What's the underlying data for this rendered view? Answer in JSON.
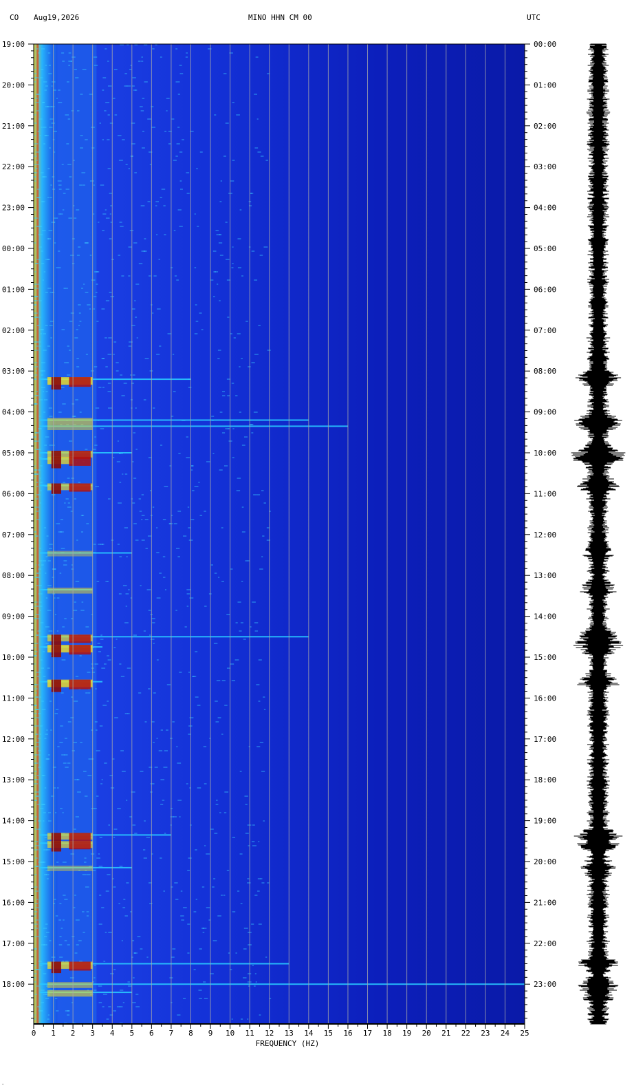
{
  "header": {
    "network": "CO",
    "date": "Aug19,2026",
    "station": "MINO HHN CM 00",
    "timezone": "UTC"
  },
  "footnote": "·",
  "colors": {
    "background_blue": "#0a1aa0",
    "deep_blue": "#0614c8",
    "cyan": "#29c8ff",
    "yellow": "#f5e020",
    "dark_red": "#8c0a0a",
    "gridline": "#a9a9a9"
  },
  "chart_data": {
    "type": "heatmap",
    "xlabel": "FREQUENCY (HZ)",
    "xlim": [
      0,
      25
    ],
    "x_ticks": [
      "0",
      "1",
      "2",
      "3",
      "4",
      "5",
      "6",
      "7",
      "8",
      "9",
      "10",
      "11",
      "12",
      "13",
      "14",
      "15",
      "16",
      "17",
      "18",
      "19",
      "20",
      "21",
      "22",
      "23",
      "24",
      "25"
    ],
    "left_time_labels": [
      "19:00",
      "20:00",
      "21:00",
      "22:00",
      "23:00",
      "00:00",
      "01:00",
      "02:00",
      "03:00",
      "04:00",
      "05:00",
      "06:00",
      "07:00",
      "08:00",
      "09:00",
      "10:00",
      "11:00",
      "12:00",
      "13:00",
      "14:00",
      "15:00",
      "16:00",
      "17:00",
      "18:00"
    ],
    "right_time_labels": [
      "00:00",
      "01:00",
      "02:00",
      "03:00",
      "04:00",
      "05:00",
      "06:00",
      "07:00",
      "08:00",
      "09:00",
      "10:00",
      "11:00",
      "12:00",
      "13:00",
      "14:00",
      "15:00",
      "16:00",
      "17:00",
      "18:00",
      "19:00",
      "20:00",
      "21:00",
      "22:00",
      "23:00"
    ],
    "hours_span": 24,
    "events": [
      {
        "hour": 8.2,
        "fmax": 8.0,
        "strength": 1.0
      },
      {
        "hour": 9.2,
        "fmax": 14.0,
        "strength": 0.7
      },
      {
        "hour": 9.35,
        "fmax": 16.0,
        "strength": 0.6
      },
      {
        "hour": 10.0,
        "fmax": 5.0,
        "strength": 0.8
      },
      {
        "hour": 10.15,
        "fmax": 2.0,
        "strength": 0.9
      },
      {
        "hour": 10.8,
        "fmax": 3.0,
        "strength": 0.8
      },
      {
        "hour": 12.45,
        "fmax": 5.0,
        "strength": 0.5
      },
      {
        "hour": 13.35,
        "fmax": 3.0,
        "strength": 0.6
      },
      {
        "hour": 14.5,
        "fmax": 14.0,
        "strength": 0.8
      },
      {
        "hour": 14.75,
        "fmax": 3.5,
        "strength": 1.0
      },
      {
        "hour": 15.6,
        "fmax": 3.5,
        "strength": 1.0
      },
      {
        "hour": 19.35,
        "fmax": 7.0,
        "strength": 0.8
      },
      {
        "hour": 19.55,
        "fmax": 3.0,
        "strength": 0.8
      },
      {
        "hour": 20.15,
        "fmax": 5.0,
        "strength": 0.5
      },
      {
        "hour": 22.5,
        "fmax": 13.0,
        "strength": 0.9
      },
      {
        "hour": 23.0,
        "fmax": 25.0,
        "strength": 0.6
      },
      {
        "hour": 23.2,
        "fmax": 5.0,
        "strength": 0.7
      }
    ]
  }
}
